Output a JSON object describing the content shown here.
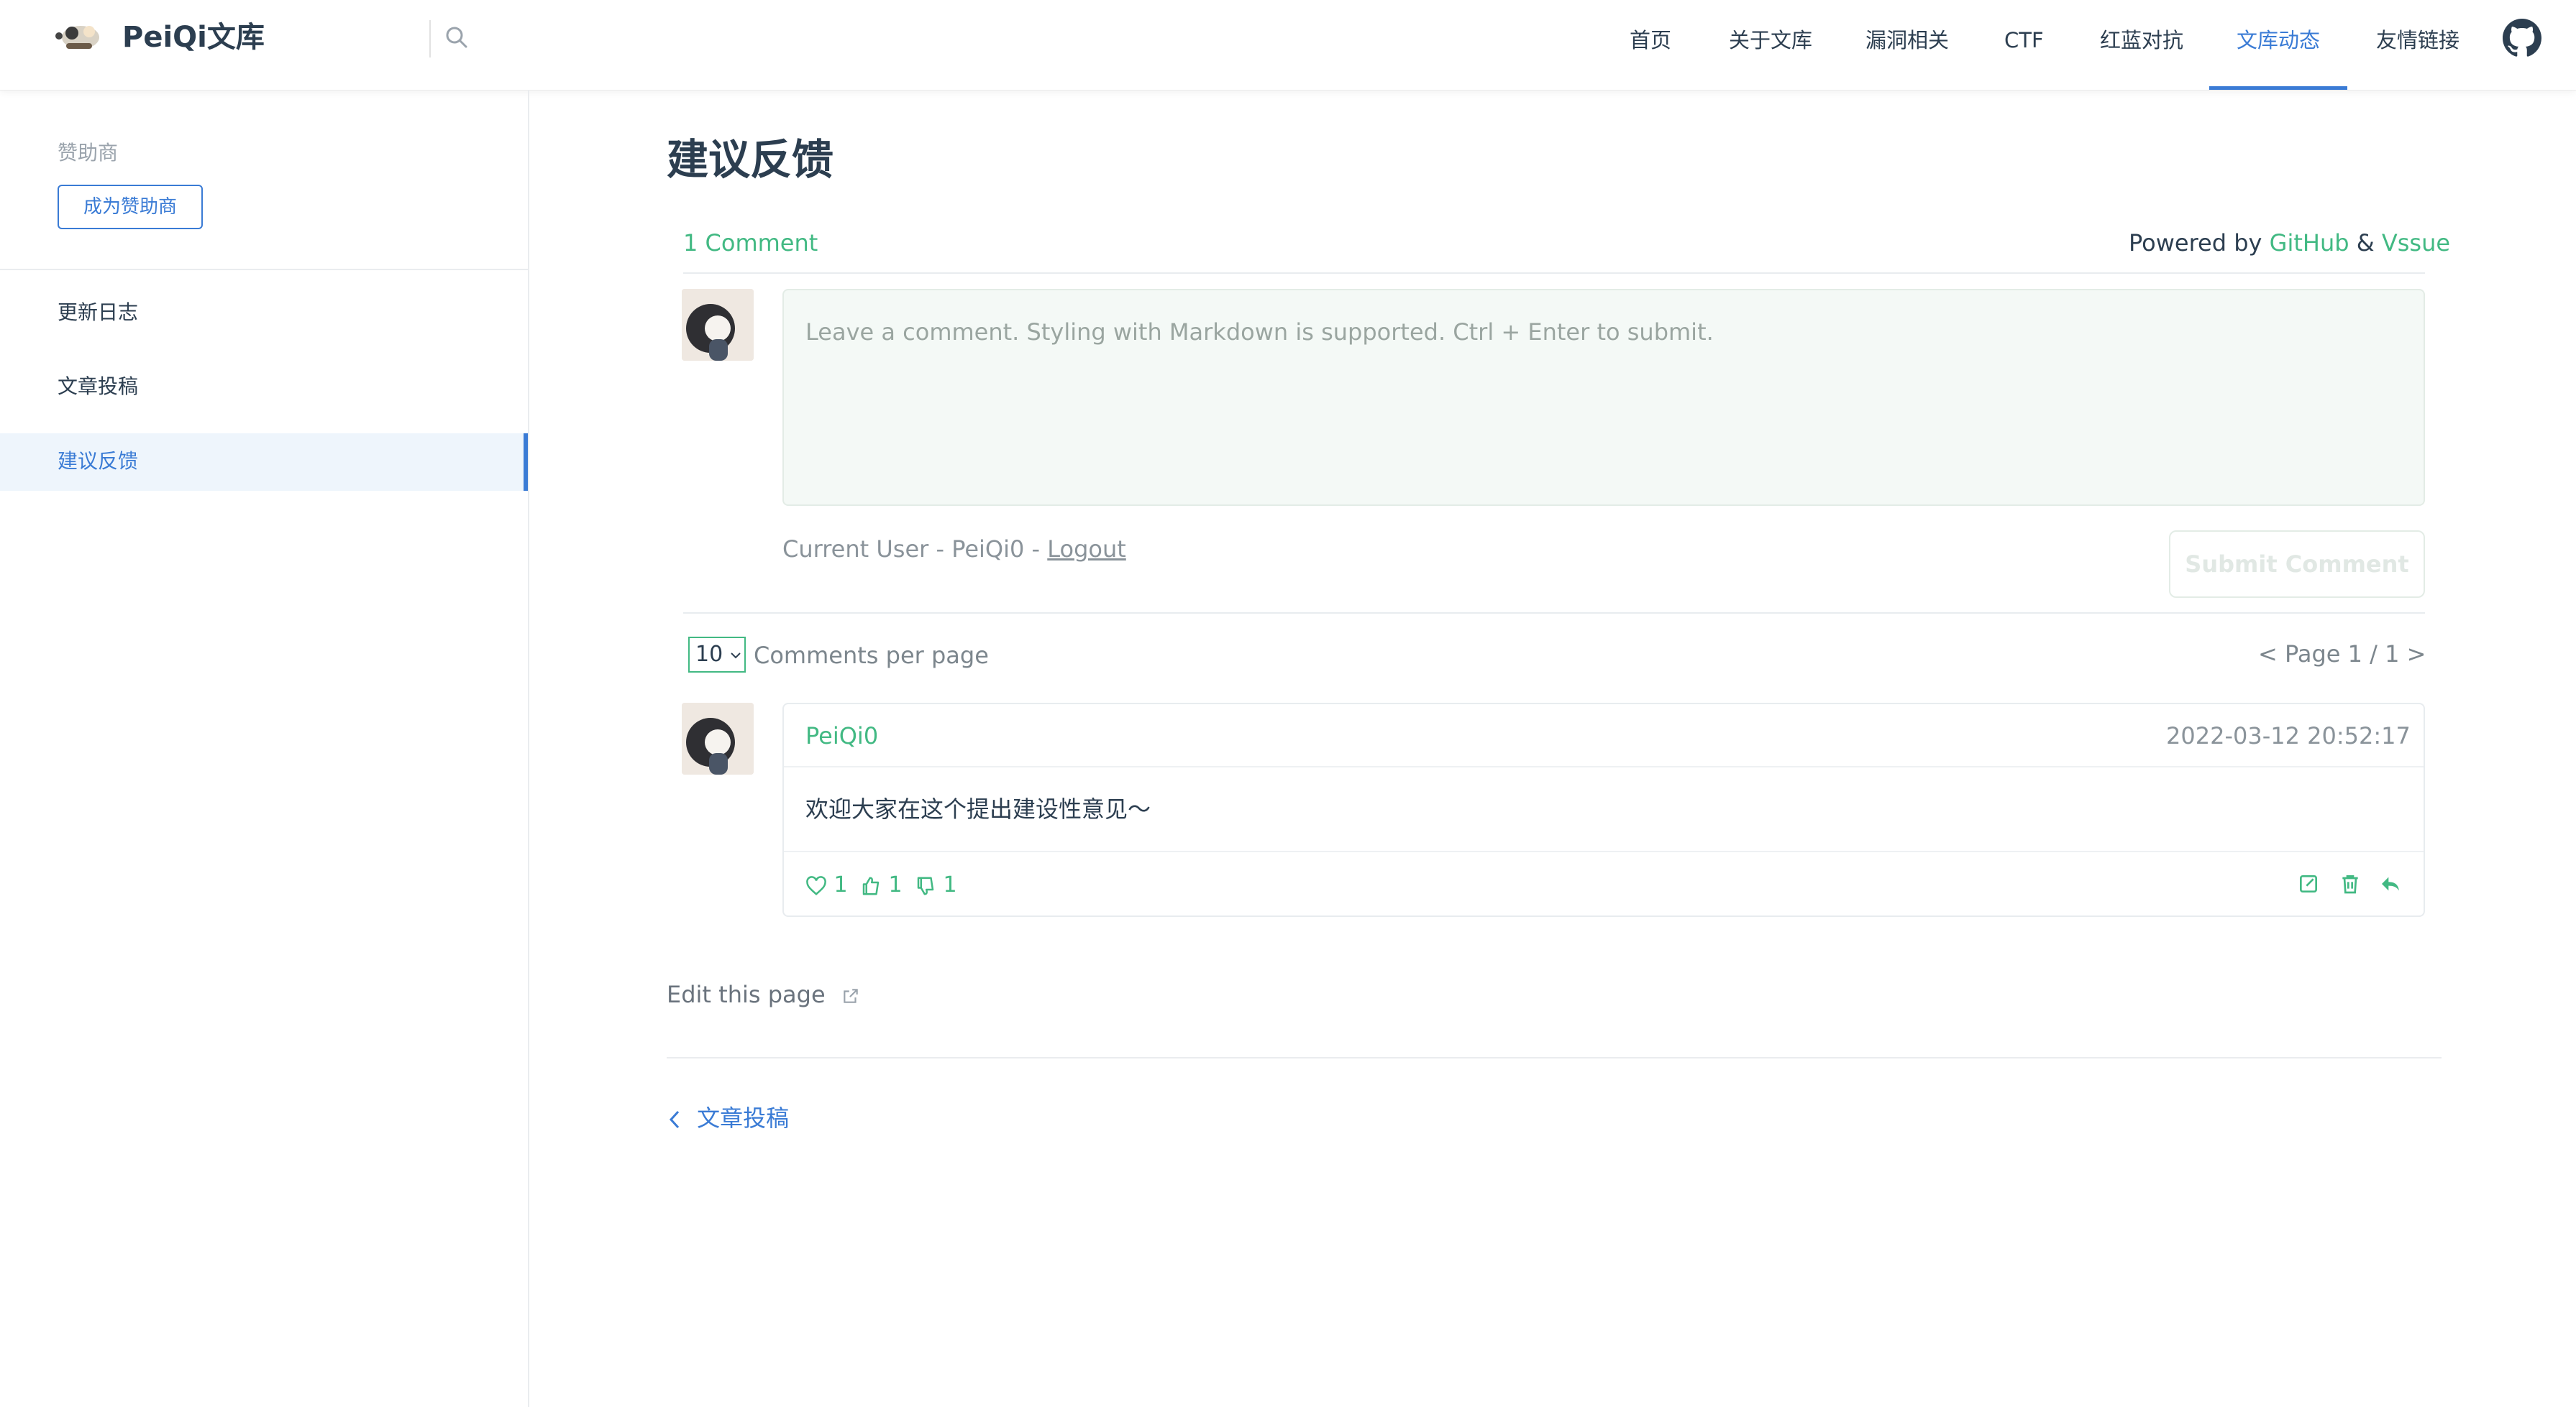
{
  "header": {
    "site_title": "PeiQi文库",
    "nav": [
      "首页",
      "关于文库",
      "漏洞相关",
      "CTF",
      "红蓝对抗",
      "文库动态",
      "友情链接"
    ],
    "active_nav": "文库动态",
    "accent_color": "#3a7bd5"
  },
  "sidebar": {
    "sponsor_label": "赞助商",
    "sponsor_button": "成为赞助商",
    "items": [
      {
        "label": "更新日志"
      },
      {
        "label": "文章投稿"
      },
      {
        "label": "建议反馈",
        "active": true
      }
    ]
  },
  "main": {
    "title": "建议反馈",
    "comments": {
      "count_label": "1 Comment",
      "powered_by": "Powered by",
      "powered_github": "GitHub",
      "powered_amp": "&",
      "powered_vssue": "Vssue",
      "placeholder": "Leave a comment. Styling with Markdown is supported. Ctrl + Enter to submit.",
      "current_user_prefix": "Current User - PeiQi0 - ",
      "logout": "Logout",
      "submit_label": "Submit Comment",
      "per_page_value": "10",
      "per_page_label": "Comments per page",
      "pagination": "<  Page 1 / 1  >",
      "list": [
        {
          "author": "PeiQi0",
          "time": "2022-03-12 20:52:17",
          "text": "欢迎大家在这个提出建设性意见～",
          "hearts": "1",
          "likes": "1",
          "dislikes": "1"
        }
      ],
      "accent_color": "#42b983"
    },
    "edit_page": "Edit this page",
    "prev_link": "文章投稿"
  }
}
